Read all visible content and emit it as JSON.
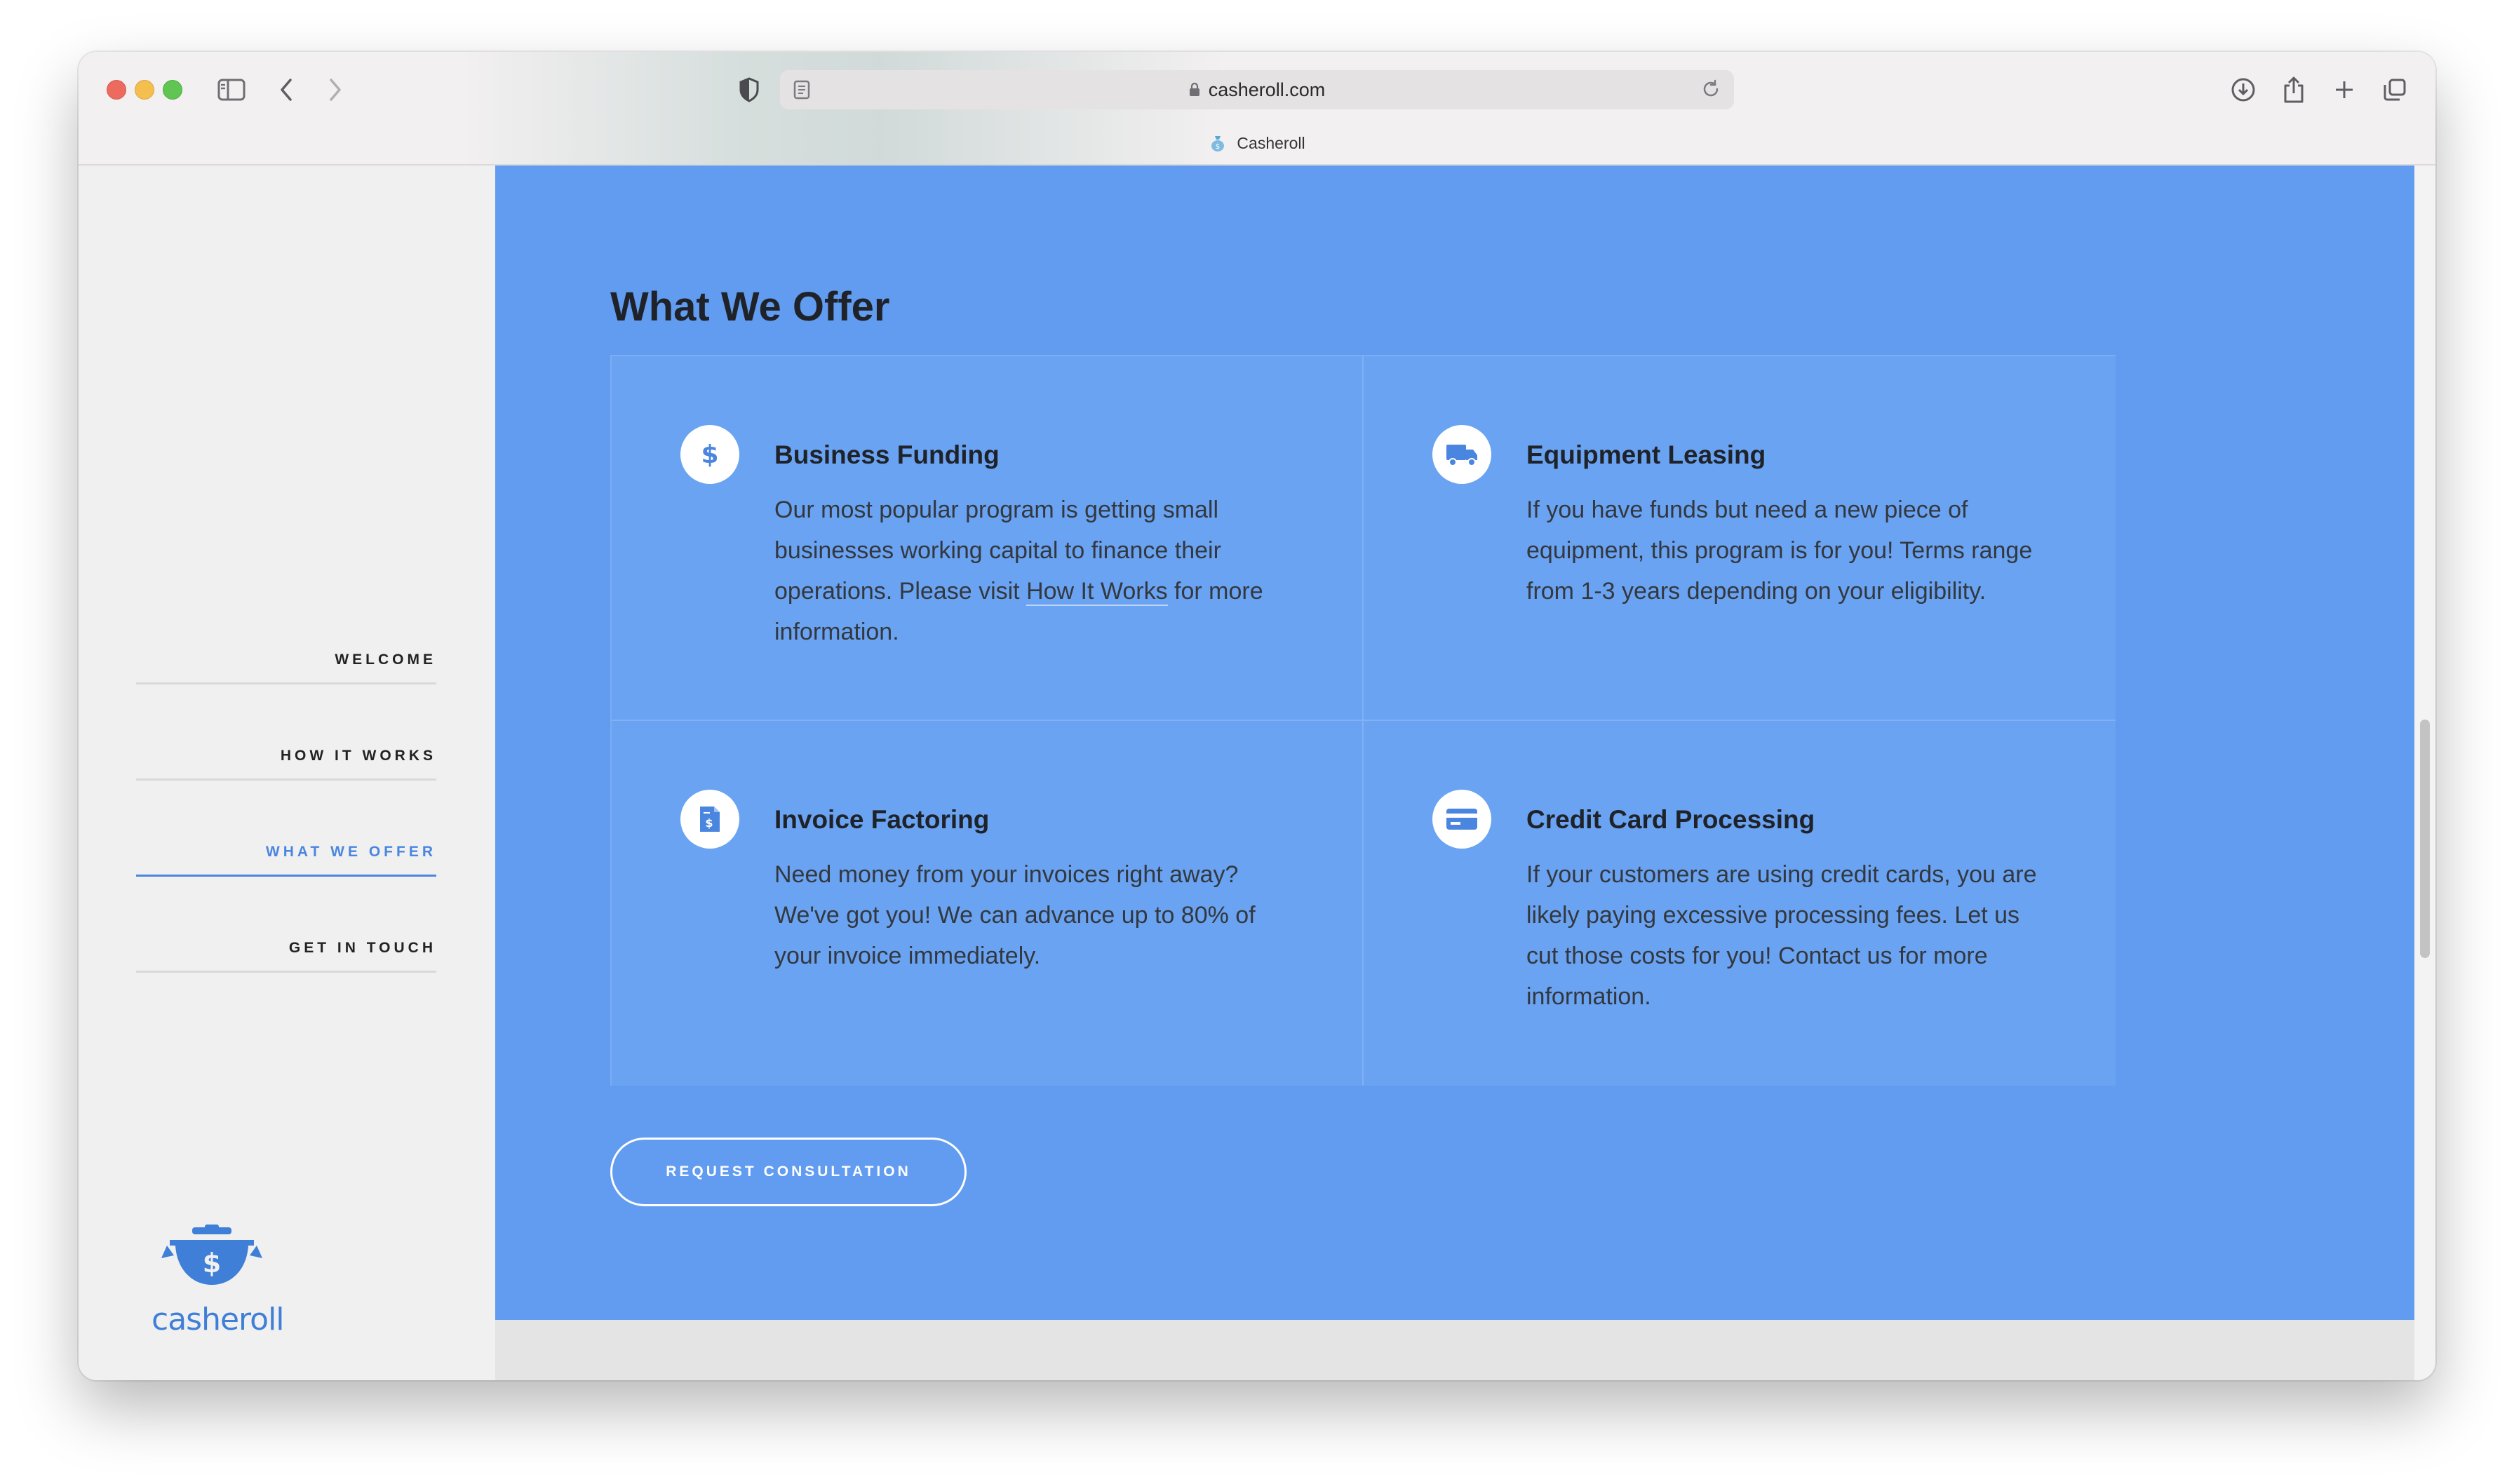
{
  "browser": {
    "url": "casheroll.com",
    "tab_title": "Casheroll"
  },
  "nav": {
    "items": [
      {
        "label": "WELCOME"
      },
      {
        "label": "HOW IT WORKS"
      },
      {
        "label": "WHAT WE OFFER",
        "active": true
      },
      {
        "label": "GET IN TOUCH"
      }
    ]
  },
  "logo": {
    "text": "casheroll"
  },
  "section": {
    "title": "What We Offer",
    "cards": [
      {
        "icon": "dollar-icon",
        "title": "Business Funding",
        "body_before": "Our most popular program is getting small businesses working capital to finance their operations. Please visit ",
        "link": "How It Works",
        "body_after": " for more information."
      },
      {
        "icon": "truck-icon",
        "title": "Equipment Leasing",
        "body": "If you have funds but need a new piece of equipment, this program is for you! Terms range from 1-3 years depending on your eligibility."
      },
      {
        "icon": "invoice-icon",
        "title": "Invoice Factoring",
        "body": "Need money from your invoices right away? We've got you! We can advance up to 80% of your invoice immediately."
      },
      {
        "icon": "credit-card-icon",
        "title": "Credit Card Processing",
        "body": "If your customers are using credit cards, you are likely paying excessive processing fees. Let us cut those costs for you! Contact us for more information."
      }
    ],
    "cta_label": "REQUEST CONSULTATION"
  },
  "colors": {
    "accent": "#619cf0",
    "nav_active": "#4a86e0"
  }
}
